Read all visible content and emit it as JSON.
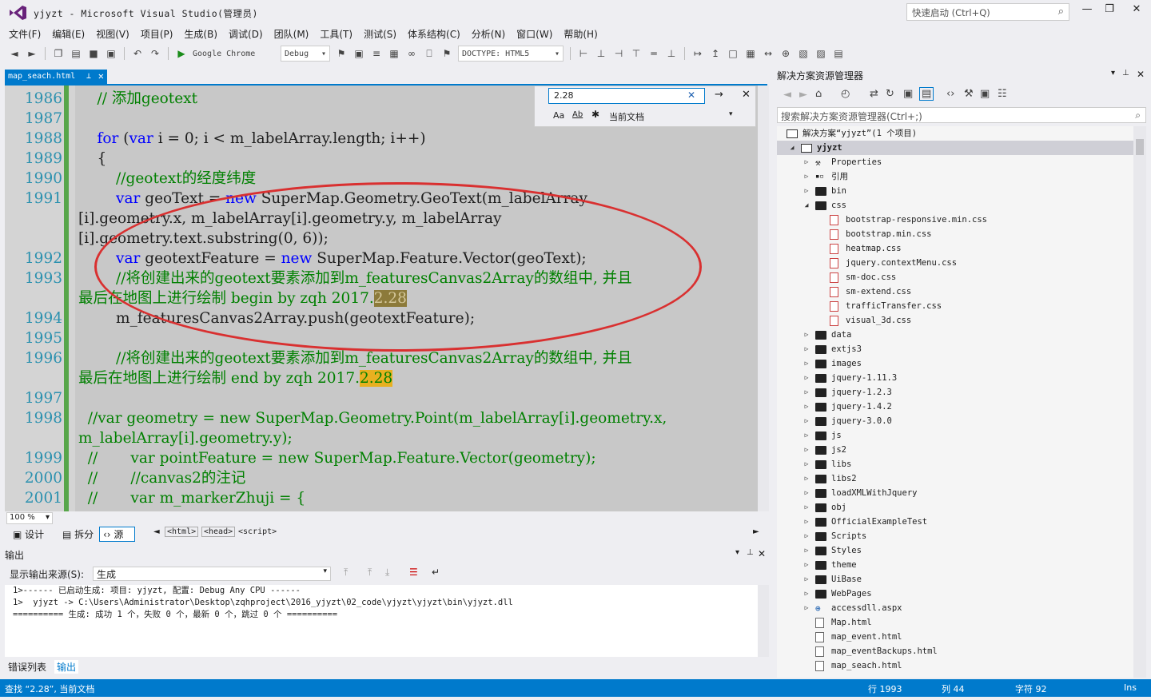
{
  "window": {
    "title": "yjyzt - Microsoft Visual Studio(管理员)",
    "quick_launch": "快速启动 (Ctrl+Q)"
  },
  "menu": [
    "文件(F)",
    "编辑(E)",
    "视图(V)",
    "项目(P)",
    "生成(B)",
    "调试(D)",
    "团队(M)",
    "工具(T)",
    "测试(S)",
    "体系结构(C)",
    "分析(N)",
    "窗口(W)",
    "帮助(H)"
  ],
  "toolbar": {
    "browser": "Google Chrome",
    "config": "Debug",
    "doctype": "DOCTYPE: HTML5"
  },
  "doc_tab": {
    "name": "map_seach.html"
  },
  "find": {
    "query": "2.28",
    "scope": "当前文档",
    "case_label": "Aa",
    "word_label": "Ab"
  },
  "editor": {
    "lines": [
      {
        "n": "1986",
        "parts": [
          {
            "t": "    // 添加geotext",
            "c": "cm"
          }
        ]
      },
      {
        "n": "1987",
        "parts": []
      },
      {
        "n": "1988",
        "parts": [
          {
            "t": "    ",
            "c": ""
          },
          {
            "t": "for",
            "c": "kw"
          },
          {
            "t": " (",
            "c": ""
          },
          {
            "t": "var",
            "c": "kw"
          },
          {
            "t": " i = 0; i < m_labelArray.length; i++)",
            "c": ""
          }
        ]
      },
      {
        "n": "1989",
        "parts": [
          {
            "t": "    {",
            "c": ""
          }
        ]
      },
      {
        "n": "1990",
        "parts": [
          {
            "t": "        //geotext的经度纬度",
            "c": "cm"
          }
        ]
      },
      {
        "n": "1991",
        "parts": [
          {
            "t": "        ",
            "c": ""
          },
          {
            "t": "var",
            "c": "kw"
          },
          {
            "t": " geoText = ",
            "c": ""
          },
          {
            "t": "new",
            "c": "kw"
          },
          {
            "t": " SuperMap.Geometry.GeoText(m_labelArray",
            "c": ""
          }
        ]
      },
      {
        "n": "",
        "wrap": true,
        "parts": [
          {
            "t": "[i].geometry.x, m_labelArray[i].geometry.y, m_labelArray",
            "c": ""
          }
        ]
      },
      {
        "n": "",
        "wrap": true,
        "parts": [
          {
            "t": "[i].geometry.text.substring(0, 6));",
            "c": ""
          }
        ]
      },
      {
        "n": "1992",
        "parts": [
          {
            "t": "        ",
            "c": ""
          },
          {
            "t": "var",
            "c": "kw"
          },
          {
            "t": " geotextFeature = ",
            "c": ""
          },
          {
            "t": "new",
            "c": "kw"
          },
          {
            "t": " SuperMap.Feature.Vector(geoText);",
            "c": ""
          }
        ]
      },
      {
        "n": "1993",
        "parts": [
          {
            "t": "        //将创建出来的geotext要素添加到m_featuresCanvas2Array的数组中, 并且",
            "c": "cm"
          }
        ]
      },
      {
        "n": "",
        "wrap": true,
        "parts": [
          {
            "t": "最后在地图上进行绘制 begin by zqh 2017.",
            "c": "cm"
          },
          {
            "t": "2.28",
            "c": "hl1"
          }
        ]
      },
      {
        "n": "1994",
        "parts": [
          {
            "t": "        m_featuresCanvas2Array.push(geotextFeature);",
            "c": ""
          }
        ]
      },
      {
        "n": "1995",
        "parts": []
      },
      {
        "n": "1996",
        "parts": [
          {
            "t": "        //将创建出来的geotext要素添加到m_featuresCanvas2Array的数组中, 并且",
            "c": "cm"
          }
        ]
      },
      {
        "n": "",
        "wrap": true,
        "parts": [
          {
            "t": "最后在地图上进行绘制 end by zqh 2017.",
            "c": "cm"
          },
          {
            "t": "2.28",
            "c": "hl2"
          }
        ]
      },
      {
        "n": "1997",
        "parts": []
      },
      {
        "n": "1998",
        "parts": [
          {
            "t": "  //var geometry = new SuperMap.Geometry.Point(m_labelArray[i].geometry.x,",
            "c": "cm"
          }
        ]
      },
      {
        "n": "",
        "wrap": true,
        "parts": [
          {
            "t": "m_labelArray[i].geometry.y);",
            "c": "cm"
          }
        ]
      },
      {
        "n": "1999",
        "parts": [
          {
            "t": "  //       var pointFeature = new SuperMap.Feature.Vector(geometry);",
            "c": "cm"
          }
        ]
      },
      {
        "n": "2000",
        "parts": [
          {
            "t": "  //       //canvas2的注记",
            "c": "cm"
          }
        ]
      },
      {
        "n": "2001",
        "parts": [
          {
            "t": "  //       var m_markerZhuji = {",
            "c": "cm"
          }
        ]
      }
    ]
  },
  "zoom": "100 %",
  "views": {
    "design": "设计",
    "split": "拆分",
    "source": "源"
  },
  "breadcrumb": [
    "<html>",
    "<head>",
    "<script>"
  ],
  "output": {
    "title": "输出",
    "source_label": "显示输出来源(S):",
    "source_value": "生成",
    "lines": [
      "1>------ 已启动生成: 项目: yjyzt, 配置: Debug Any CPU ------",
      "1>  yjyzt -> C:\\Users\\Administrator\\Desktop\\zqhproject\\2016_yjyzt\\02_code\\yjyzt\\yjyzt\\bin\\yjyzt.dll",
      "========== 生成: 成功 1 个，失败 0 个，最新 0 个，跳过 0 个 =========="
    ],
    "tabs": [
      "错误列表",
      "输出"
    ]
  },
  "status": {
    "left": "查找 “2.28”, 当前文档",
    "line": "行 1993",
    "col": "列 44",
    "char": "字符 92",
    "mode": "Ins"
  },
  "solution_explorer": {
    "title": "解决方案资源管理器",
    "search_placeholder": "搜索解决方案资源管理器(Ctrl+;)",
    "items": [
      {
        "label": "解决方案“yjyzt”(1 个项目)",
        "depth": 0,
        "icon": "solution",
        "arrow": ""
      },
      {
        "label": "yjyzt",
        "depth": 1,
        "icon": "project",
        "arrow": "down",
        "selected": true
      },
      {
        "label": "Properties",
        "depth": 2,
        "icon": "wrench",
        "arrow": "right"
      },
      {
        "label": "引用",
        "depth": 2,
        "icon": "refs",
        "arrow": "right"
      },
      {
        "label": "bin",
        "depth": 2,
        "icon": "folder",
        "arrow": "right"
      },
      {
        "label": "css",
        "depth": 2,
        "icon": "folder",
        "arrow": "down"
      },
      {
        "label": "bootstrap-responsive.min.css",
        "depth": 3,
        "icon": "css",
        "arrow": ""
      },
      {
        "label": "bootstrap.min.css",
        "depth": 3,
        "icon": "css",
        "arrow": ""
      },
      {
        "label": "heatmap.css",
        "depth": 3,
        "icon": "css",
        "arrow": ""
      },
      {
        "label": "jquery.contextMenu.css",
        "depth": 3,
        "icon": "css",
        "arrow": ""
      },
      {
        "label": "sm-doc.css",
        "depth": 3,
        "icon": "css",
        "arrow": ""
      },
      {
        "label": "sm-extend.css",
        "depth": 3,
        "icon": "css",
        "arrow": ""
      },
      {
        "label": "trafficTransfer.css",
        "depth": 3,
        "icon": "css",
        "arrow": ""
      },
      {
        "label": "visual_3d.css",
        "depth": 3,
        "icon": "css",
        "arrow": ""
      },
      {
        "label": "data",
        "depth": 2,
        "icon": "folder",
        "arrow": "right"
      },
      {
        "label": "extjs3",
        "depth": 2,
        "icon": "folder",
        "arrow": "right"
      },
      {
        "label": "images",
        "depth": 2,
        "icon": "folder",
        "arrow": "right"
      },
      {
        "label": "jquery-1.11.3",
        "depth": 2,
        "icon": "folder",
        "arrow": "right"
      },
      {
        "label": "jquery-1.2.3",
        "depth": 2,
        "icon": "folder",
        "arrow": "right"
      },
      {
        "label": "jquery-1.4.2",
        "depth": 2,
        "icon": "folder",
        "arrow": "right"
      },
      {
        "label": "jquery-3.0.0",
        "depth": 2,
        "icon": "folder",
        "arrow": "right"
      },
      {
        "label": "js",
        "depth": 2,
        "icon": "folder",
        "arrow": "right"
      },
      {
        "label": "js2",
        "depth": 2,
        "icon": "folder",
        "arrow": "right"
      },
      {
        "label": "libs",
        "depth": 2,
        "icon": "folder",
        "arrow": "right"
      },
      {
        "label": "libs2",
        "depth": 2,
        "icon": "folder",
        "arrow": "right"
      },
      {
        "label": "loadXMLWithJquery",
        "depth": 2,
        "icon": "folder",
        "arrow": "right"
      },
      {
        "label": "obj",
        "depth": 2,
        "icon": "folder",
        "arrow": "right"
      },
      {
        "label": "OfficialExampleTest",
        "depth": 2,
        "icon": "folder",
        "arrow": "right"
      },
      {
        "label": "Scripts",
        "depth": 2,
        "icon": "folder",
        "arrow": "right"
      },
      {
        "label": "Styles",
        "depth": 2,
        "icon": "folder",
        "arrow": "right"
      },
      {
        "label": "theme",
        "depth": 2,
        "icon": "folder",
        "arrow": "right"
      },
      {
        "label": "UiBase",
        "depth": 2,
        "icon": "folder",
        "arrow": "right"
      },
      {
        "label": "WebPages",
        "depth": 2,
        "icon": "folder",
        "arrow": "right"
      },
      {
        "label": "accessdll.aspx",
        "depth": 2,
        "icon": "aspx",
        "arrow": "right"
      },
      {
        "label": "Map.html",
        "depth": 2,
        "icon": "html",
        "arrow": ""
      },
      {
        "label": "map_event.html",
        "depth": 2,
        "icon": "html",
        "arrow": ""
      },
      {
        "label": "map_eventBackups.html",
        "depth": 2,
        "icon": "html",
        "arrow": ""
      },
      {
        "label": "map_seach.html",
        "depth": 2,
        "icon": "html",
        "arrow": ""
      }
    ]
  },
  "colors": {
    "accent": "#007acc",
    "highlight_ellipse": "#d93030"
  }
}
